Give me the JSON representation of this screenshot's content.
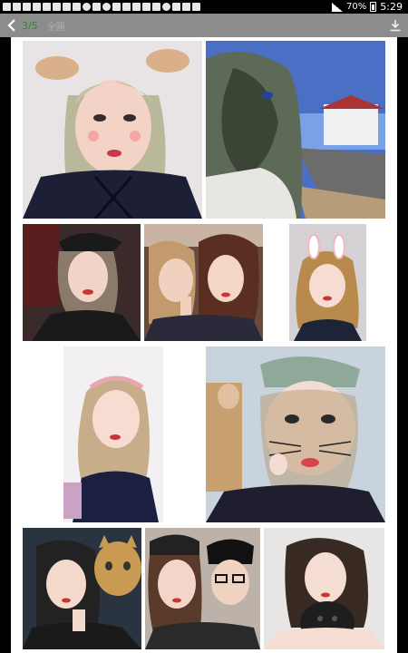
{
  "toolbar": {
    "counter": "3/5",
    "title": "全圖"
  },
  "status": {
    "battery": "70%",
    "time": "5:29"
  },
  "photos": [
    {
      "name": "photo-selfie-deer-filter"
    },
    {
      "name": "photo-windy-hair-street"
    },
    {
      "name": "photo-car-selfie-cap"
    },
    {
      "name": "photo-two-friends-peace-sign"
    },
    {
      "name": "photo-bunny-filter"
    },
    {
      "name": "photo-flower-crown-selfie"
    },
    {
      "name": "photo-cat-whisker-filter"
    },
    {
      "name": "photo-selfie-with-cat"
    },
    {
      "name": "photo-couple-selfie"
    },
    {
      "name": "photo-holding-puppy"
    }
  ]
}
